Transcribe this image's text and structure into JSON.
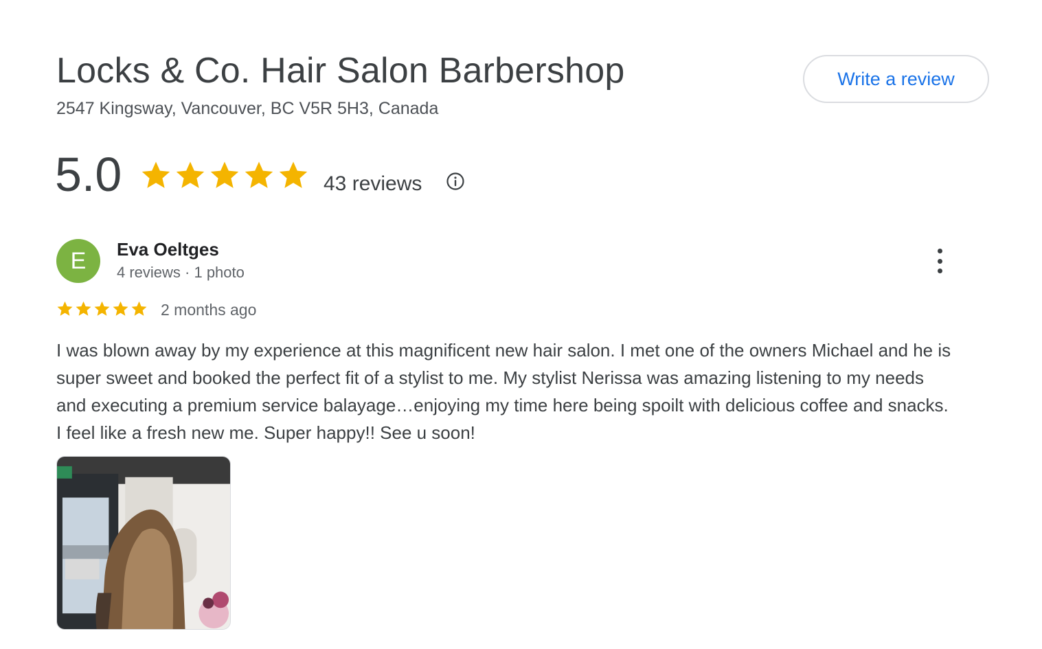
{
  "business": {
    "name": "Locks & Co. Hair Salon Barbershop",
    "address": "2547 Kingsway, Vancouver, BC V5R 5H3, Canada",
    "write_review_label": "Write a review"
  },
  "summary": {
    "rating": "5.0",
    "stars": 5,
    "review_count": "43 reviews",
    "info_icon": "info-circle-icon"
  },
  "review": {
    "avatar_letter": "E",
    "avatar_color": "#7cb342",
    "author": "Eva Oeltges",
    "author_meta": "4 reviews · 1 photo",
    "stars": 5,
    "date": "2 months ago",
    "text": "I was blown away by my experience at this magnificent new hair salon. I met one of the owners Michael and he is super sweet and booked the perfect fit of a stylist to me. My stylist Nerissa was amazing listening to my needs and executing a premium service balayage…enjoying my time here being spoilt with delicious coffee and snacks. I feel like a fresh new me. Super happy!! See u soon!",
    "more_icon": "more-vertical-icon"
  },
  "colors": {
    "star": "#f4b400",
    "link": "#1a73e8"
  }
}
